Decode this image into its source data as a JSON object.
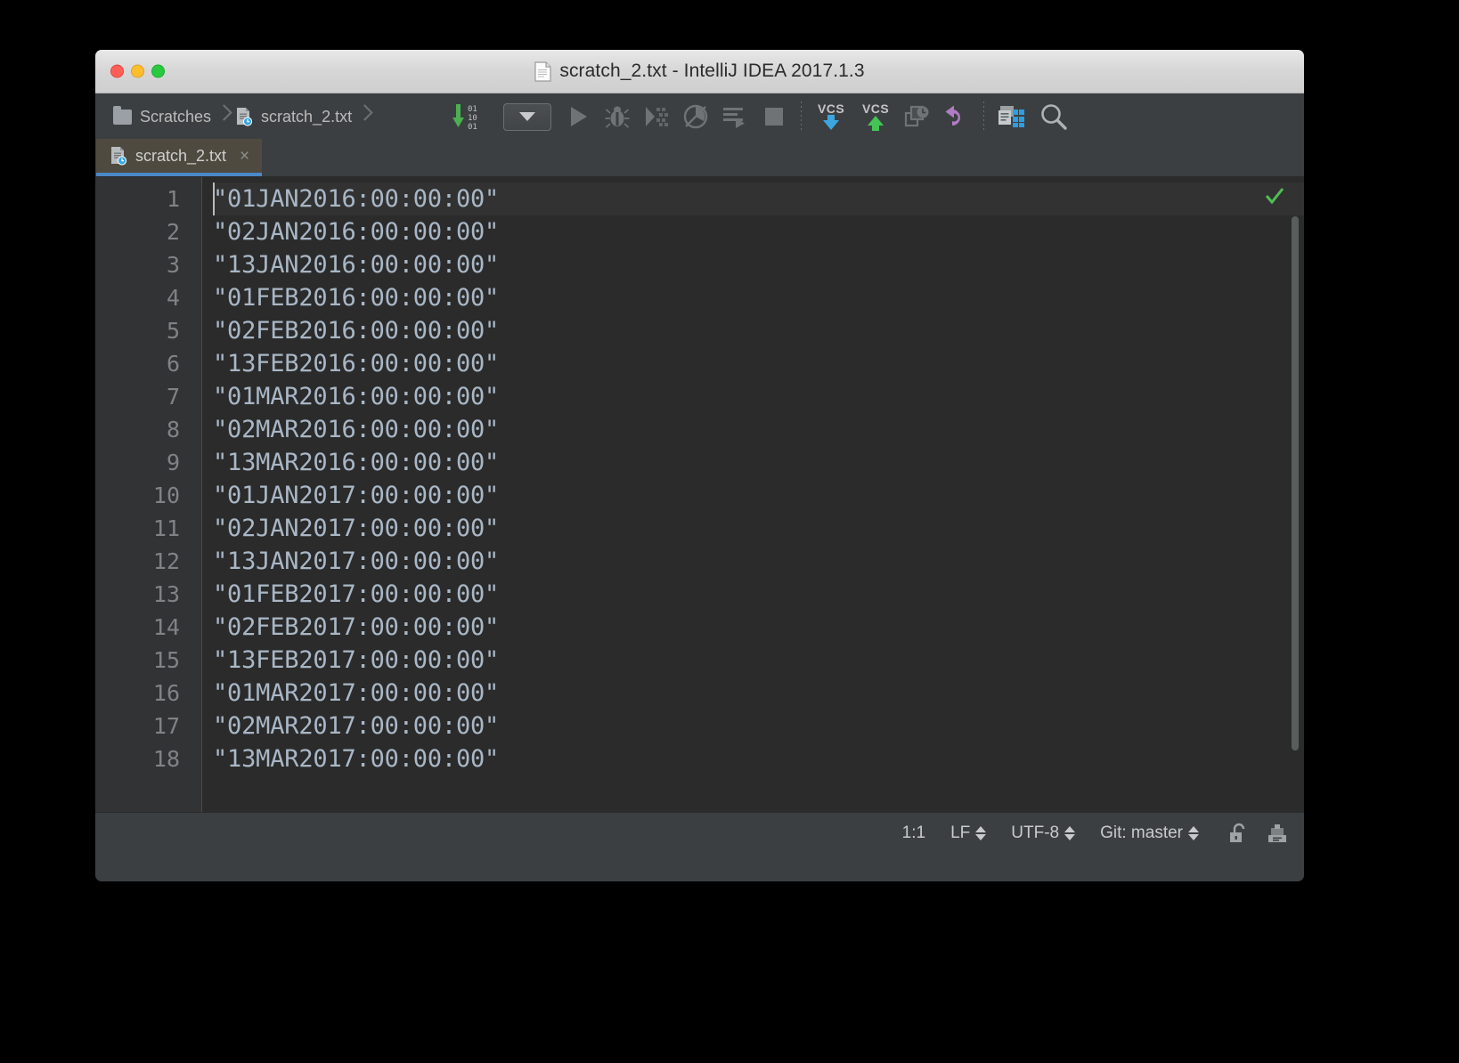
{
  "window": {
    "title": "scratch_2.txt - IntelliJ IDEA 2017.1.3",
    "title_icon": "document-icon",
    "traffic_lights": [
      {
        "name": "close-button",
        "color": "#ff5f57"
      },
      {
        "name": "minimize-button",
        "color": "#ffbd2e"
      },
      {
        "name": "maximize-button",
        "color": "#28c940"
      }
    ]
  },
  "breadcrumb": {
    "items": [
      {
        "label": "Scratches",
        "icon": "folder-icon"
      },
      {
        "label": "scratch_2.txt",
        "icon": "scratch-file-icon"
      }
    ]
  },
  "toolbar": {
    "buttons": [
      {
        "name": "update-project-button",
        "icon": "download-binary-icon",
        "label": ""
      },
      {
        "name": "run-configurations-combo",
        "icon": "chevron-down-icon",
        "label": ""
      },
      {
        "name": "run-button",
        "icon": "play-icon",
        "label": ""
      },
      {
        "name": "debug-button",
        "icon": "bug-icon",
        "label": ""
      },
      {
        "name": "coverage-button",
        "icon": "coverage-icon",
        "label": ""
      },
      {
        "name": "profile-button",
        "icon": "profile-icon",
        "label": ""
      },
      {
        "name": "run-with-console-button",
        "icon": "run-console-icon",
        "label": ""
      },
      {
        "name": "stop-button",
        "icon": "stop-square-icon",
        "label": ""
      },
      {
        "name": "vcs-update-button",
        "icon": "vcs-down-arrow-icon",
        "label": "VCS"
      },
      {
        "name": "vcs-commit-button",
        "icon": "vcs-up-arrow-icon",
        "label": "VCS"
      },
      {
        "name": "vcs-history-button",
        "icon": "file-history-icon",
        "label": ""
      },
      {
        "name": "undo-button",
        "icon": "undo-arrow-icon",
        "label": ""
      },
      {
        "name": "settings-button",
        "icon": "settings-grid-icon",
        "label": ""
      },
      {
        "name": "search-everywhere-button",
        "icon": "search-icon",
        "label": ""
      }
    ],
    "binary_digits": [
      "01",
      "10",
      "01"
    ],
    "vcs_text": "VCS",
    "accent_colors": {
      "green": "#4caf50",
      "blue": "#3ba7e0",
      "purple": "#b07cc6",
      "tab_underline": "#4a88c7"
    }
  },
  "tabs": [
    {
      "label": "scratch_2.txt",
      "icon": "scratch-file-icon",
      "close": "×",
      "active": true
    }
  ],
  "editor": {
    "line_numbers": [
      "1",
      "2",
      "3",
      "4",
      "5",
      "6",
      "7",
      "8",
      "9",
      "10",
      "11",
      "12",
      "13",
      "14",
      "15",
      "16",
      "17",
      "18"
    ],
    "lines": [
      "\"01JAN2016:00:00:00\"",
      "\"02JAN2016:00:00:00\"",
      "\"13JAN2016:00:00:00\"",
      "\"01FEB2016:00:00:00\"",
      "\"02FEB2016:00:00:00\"",
      "\"13FEB2016:00:00:00\"",
      "\"01MAR2016:00:00:00\"",
      "\"02MAR2016:00:00:00\"",
      "\"13MAR2016:00:00:00\"",
      "\"01JAN2017:00:00:00\"",
      "\"02JAN2017:00:00:00\"",
      "\"13JAN2017:00:00:00\"",
      "\"01FEB2017:00:00:00\"",
      "\"02FEB2017:00:00:00\"",
      "\"13FEB2017:00:00:00\"",
      "\"01MAR2017:00:00:00\"",
      "\"02MAR2017:00:00:00\"",
      "\"13MAR2017:00:00:00\""
    ],
    "inspection_status": "ok-checkmark",
    "text_color": "#a9b7c6",
    "background": "#2b2b2b"
  },
  "statusbar": {
    "caret_position": "1:1",
    "line_separator": "LF",
    "encoding": "UTF-8",
    "vcs_branch": "Git: master",
    "lock_icon": "unlocked-padlock-icon",
    "event_log_icon": "event-log-icon"
  }
}
